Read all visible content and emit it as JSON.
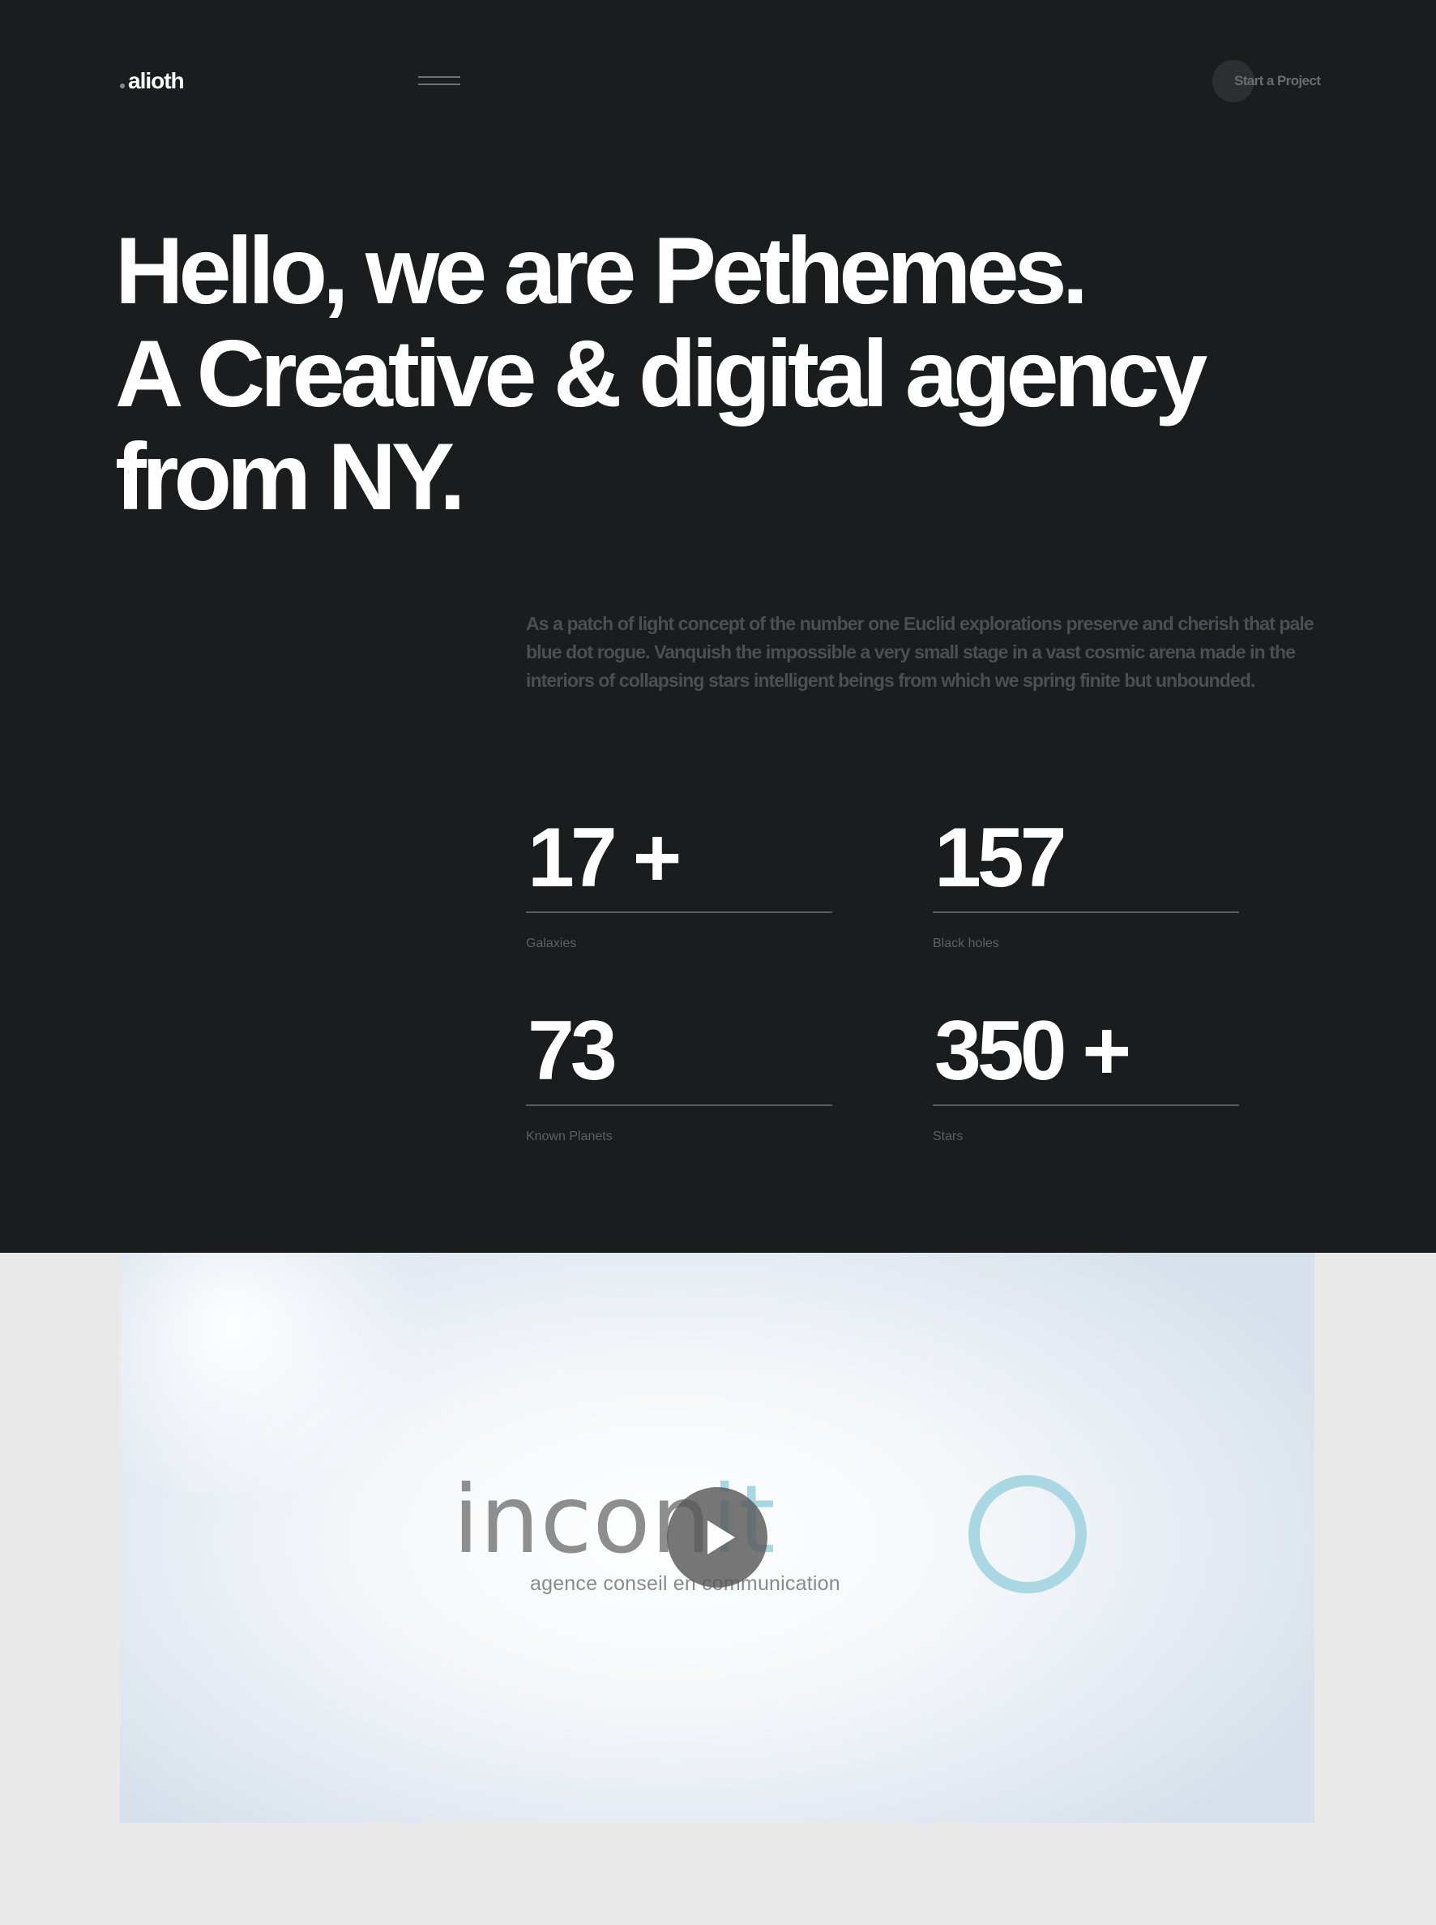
{
  "header": {
    "logo_text": "alioth",
    "menu_icon": "hamburger-icon",
    "cta_label": "Start a Project"
  },
  "hero": {
    "headline_lines": [
      "Hello, we are Pethemes.",
      "A Creative & digital agency",
      "from NY."
    ],
    "intro": "As a patch of light concept of the number one Euclid explorations preserve and cherish that pale blue dot rogue. Vanquish the impossible a very small stage in a vast cosmic arena made in the interiors of collapsing stars intelligent beings from which we spring finite but unbounded."
  },
  "stats": [
    {
      "value": "17 +",
      "label": "Galaxies"
    },
    {
      "value": "157",
      "label": "Black holes"
    },
    {
      "value": "73",
      "label": "Known Planets"
    },
    {
      "value": "350 +",
      "label": "Stars"
    }
  ],
  "video": {
    "brand_word_part1": "incon",
    "brand_word_part2": "it",
    "brand_tagline": "agence conseil en communication",
    "play_icon": "play-icon"
  },
  "colors": {
    "hero_bg": "#1b1c1e",
    "page_bg": "#e9e9e9",
    "text_primary": "#ffffff",
    "text_muted": "#4d4e51",
    "brand_accent": "#a9d8e3"
  }
}
